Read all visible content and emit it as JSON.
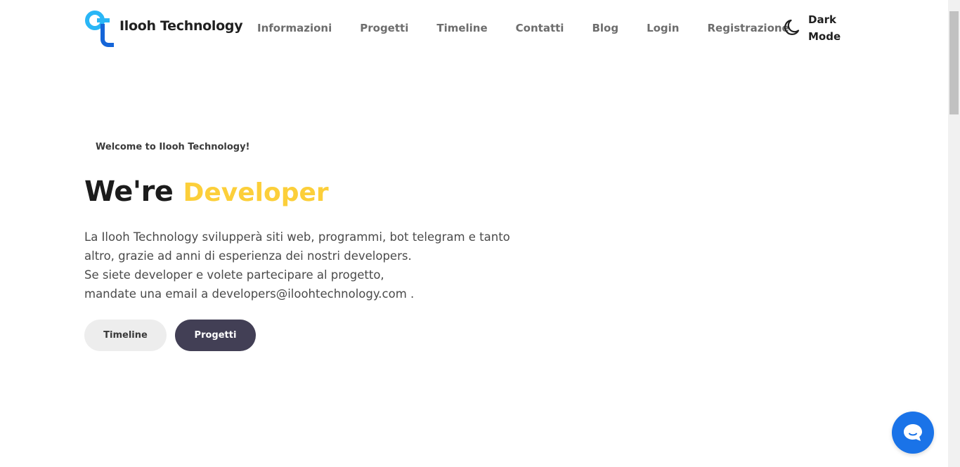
{
  "brand": {
    "name": "Ilooh Technology",
    "colors": {
      "cyan": "#29b6f6",
      "blue": "#1565d8"
    }
  },
  "nav": {
    "items": [
      {
        "label": "Informazioni"
      },
      {
        "label": "Progetti"
      },
      {
        "label": "Timeline"
      },
      {
        "label": "Contatti"
      },
      {
        "label": "Blog"
      },
      {
        "label": "Login"
      },
      {
        "label": "Registrazione"
      }
    ],
    "dark_mode": {
      "line1": "Dark",
      "line2": "Mode",
      "icon": "moon-icon"
    }
  },
  "hero": {
    "welcome": "Welcome to Ilooh Technology!",
    "headline_static": "We're",
    "headline_accent": "Developer",
    "accent_color": "#fccf3a",
    "description": [
      "La Ilooh Technology svilupperà siti web, programmi, bot telegram e tanto",
      "altro, grazie ad anni di esperienza dei nostri developers.",
      "Se siete developer e volete partecipare al progetto,",
      "mandate una email a developers@iloohtechnology.com ."
    ],
    "buttons": {
      "timeline": "Timeline",
      "progetti": "Progetti"
    }
  },
  "chat": {
    "icon": "chat-bubble-icon",
    "color": "#1a73e8"
  }
}
